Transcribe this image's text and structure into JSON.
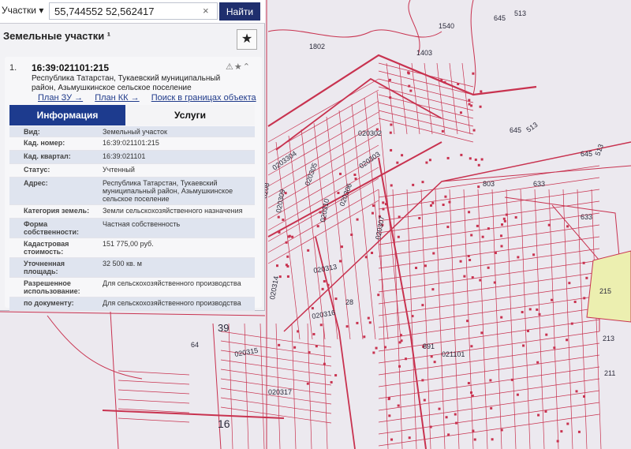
{
  "search": {
    "layer_label": "Участки ▾",
    "query": "55,744552 52,562417",
    "clear_label": "×",
    "find_label": "Найти"
  },
  "panel": {
    "title": "Земельные участки ¹",
    "star_glyph": "★",
    "item_number": "1.",
    "cad_number": "16:39:021101:215",
    "tools": "⚠★⌃",
    "address": "Республика Татарстан, Тукаевский муниципальный район, Азьмушкинское сельское поселение",
    "links": [
      "План ЗУ →",
      "План КК →",
      "Поиск в границах объекта →"
    ],
    "tabs": [
      "Информация",
      "Услуги"
    ],
    "fields": [
      {
        "label": "Вид:",
        "value": "Земельный участок"
      },
      {
        "label": "Кад. номер:",
        "value": "16:39:021101:215"
      },
      {
        "label": "Кад. квартал:",
        "value": "16:39:021101"
      },
      {
        "label": "Статус:",
        "value": "Учтенный"
      },
      {
        "label": "Адрес:",
        "value": "Республика Татарстан, Тукаевский муниципальный район, Азьмушкинское сельское поселение"
      },
      {
        "label": "Категория земель:",
        "value": "Земли сельскохозяйственного назначения"
      },
      {
        "label": "Форма собственности:",
        "value": "Частная собственность"
      },
      {
        "label": "Кадастровая стоимость:",
        "value": "151 775,00 руб."
      },
      {
        "label": "Уточненная площадь:",
        "value": "32 500 кв. м"
      },
      {
        "label": "Разрешенное использование:",
        "value": "Для сельскохозяйственного производства"
      },
      {
        "label": "по документу:",
        "value": "Для сельскохозяйственного производства"
      }
    ]
  },
  "map": {
    "colors": {
      "parcel_line": "#c8324f",
      "highlight": "#ecefb0",
      "background": "#ece9ef"
    },
    "labels": [
      "1540",
      "645",
      "513",
      "1802",
      "1403",
      "645",
      "513",
      "020302",
      "645",
      "513",
      "0203304",
      "020303",
      "020305",
      "020306",
      "803",
      "633",
      "633",
      "020309",
      "020310",
      "020307",
      "0208",
      "020313",
      "020314",
      "28",
      "020316",
      "021101",
      "39",
      "64",
      "020315",
      "020317",
      "16",
      "215",
      "213",
      "211",
      "891"
    ]
  }
}
